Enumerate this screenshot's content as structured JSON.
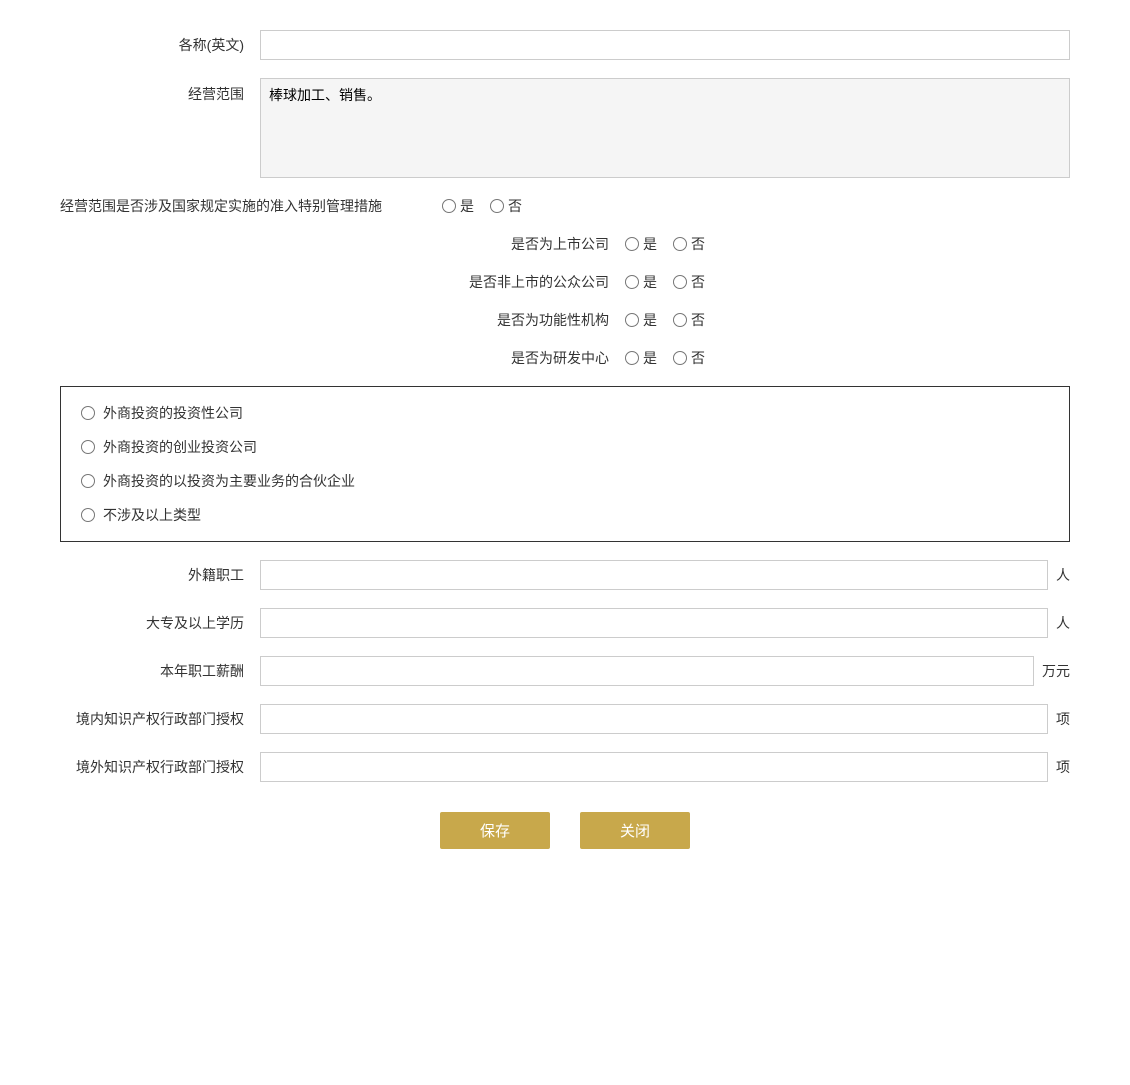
{
  "form": {
    "fields": {
      "name_en_label": "各称(英文)",
      "business_scope_label": "经营范围",
      "business_scope_value": "棒球加工、销售。",
      "special_mgmt_label": "经营范围是否涉及国家规定实施的准入特别管理措施",
      "listed_company_label": "是否为上市公司",
      "non_listed_public_label": "是否非上市的公众公司",
      "functional_org_label": "是否为功能性机构",
      "rd_center_label": "是否为研发中心",
      "foreign_employee_label": "外籍职工",
      "foreign_employee_unit": "人",
      "college_edu_label": "大专及以上学历",
      "college_edu_unit": "人",
      "annual_salary_label": "本年职工薪酬",
      "annual_salary_unit": "万元",
      "domestic_ip_label": "境内知识产权行政部门授权",
      "domestic_ip_unit": "项",
      "foreign_ip_label": "境外知识产权行政部门授权",
      "foreign_ip_unit": "项"
    },
    "radio_options": {
      "yes": "是",
      "no": "否"
    },
    "checkbox_options": [
      "外商投资的投资性公司",
      "外商投资的创业投资公司",
      "外商投资的以投资为主要业务的合伙企业",
      "不涉及以上类型"
    ],
    "buttons": {
      "save": "保存",
      "close": "关闭"
    },
    "colors": {
      "button_bg": "#c8a84b",
      "button_text": "#ffffff",
      "border": "#ccc",
      "checkbox_border": "#333"
    }
  }
}
